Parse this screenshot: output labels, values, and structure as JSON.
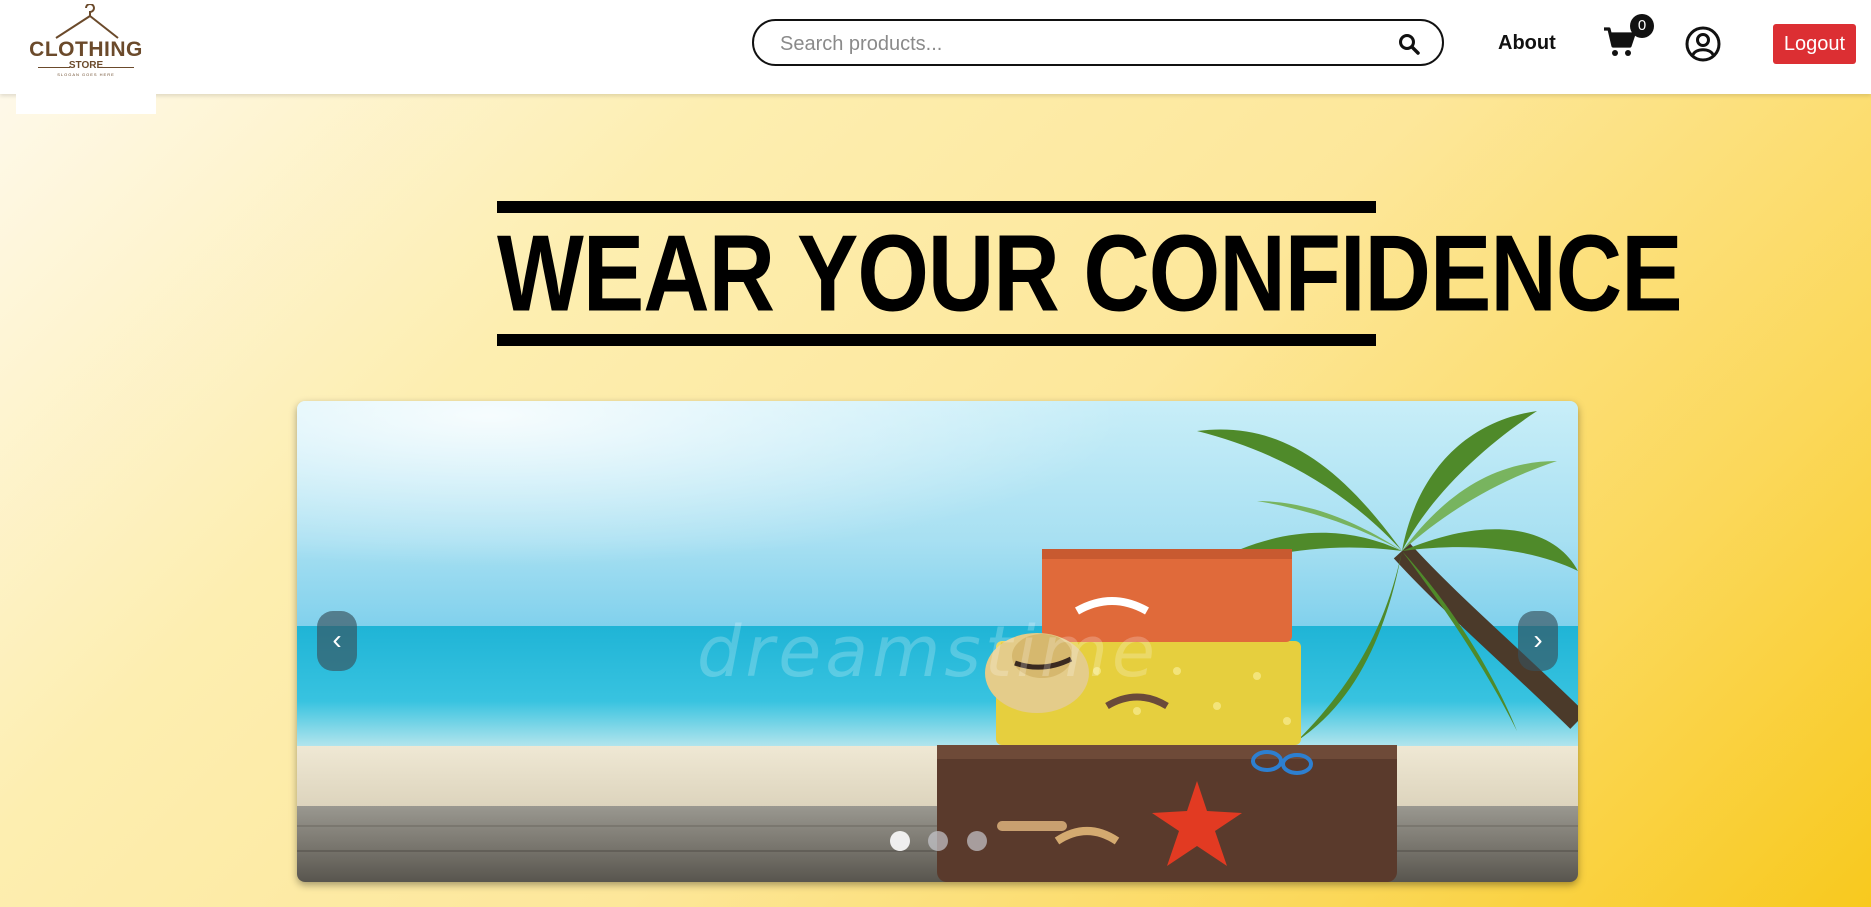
{
  "brand": {
    "logo_text": "CLOTHING",
    "logo_sub": "STORE",
    "logo_tagline": "SLOGAN GOES HERE"
  },
  "header": {
    "search_placeholder": "Search products...",
    "search_value": "",
    "about_label": "About",
    "cart_count": "0",
    "logout_label": "Logout",
    "logout_color": "#dc2f33"
  },
  "hero": {
    "title": "WEAR YOUR CONFIDENCE"
  },
  "carousel": {
    "prev_symbol": "‹",
    "next_symbol": "›",
    "slide_count": 3,
    "active_slide": 1,
    "watermark": "dreamstime"
  },
  "icons": [
    "hanger-icon",
    "search-icon",
    "cart-icon",
    "account-icon"
  ]
}
